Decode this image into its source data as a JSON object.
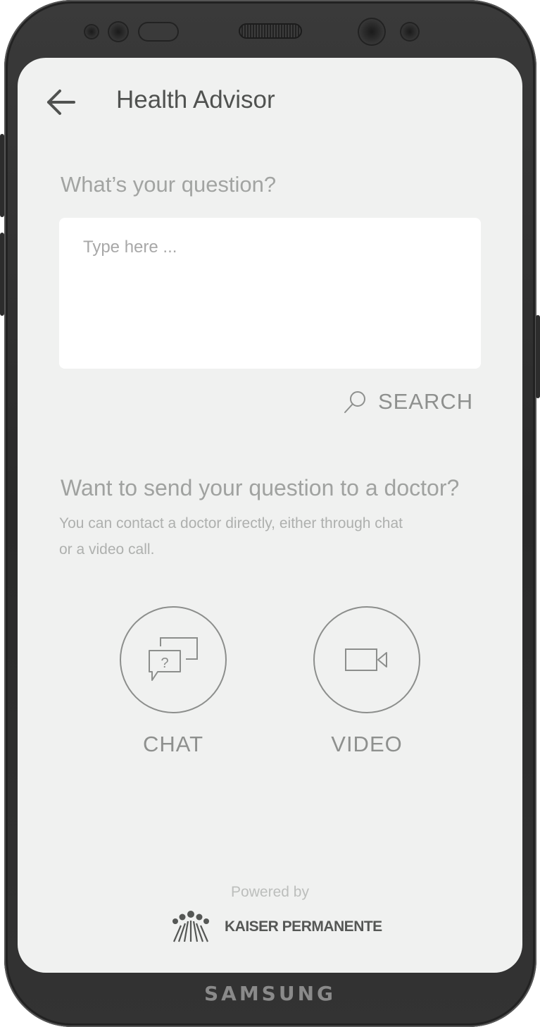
{
  "device": {
    "brand": "SAMSUNG"
  },
  "header": {
    "title": "Health Advisor",
    "back_icon": "arrow-left-icon"
  },
  "question": {
    "label": "What’s your question?",
    "input_value": "",
    "input_placeholder": "Type here ...",
    "search_label": "SEARCH",
    "search_icon": "search-icon"
  },
  "doctor": {
    "heading": "Want to send your question to a doctor?",
    "description_line1": "You can contact a doctor directly, either through chat",
    "description_line2": "or a video call.",
    "actions": [
      {
        "label": "CHAT",
        "icon": "chat-question-icon"
      },
      {
        "label": "VIDEO",
        "icon": "video-camera-icon"
      }
    ]
  },
  "footer": {
    "powered_by": "Powered by",
    "partner_name": "KAISER PERMANENTE",
    "partner_logo_icon": "kaiser-permanente-logo"
  },
  "colors": {
    "screen_background": "#f0f1f0",
    "text_dark": "#505250",
    "text_muted": "#a0a2a0",
    "outline": "#8c8e8c",
    "input_background": "#ffffff"
  }
}
